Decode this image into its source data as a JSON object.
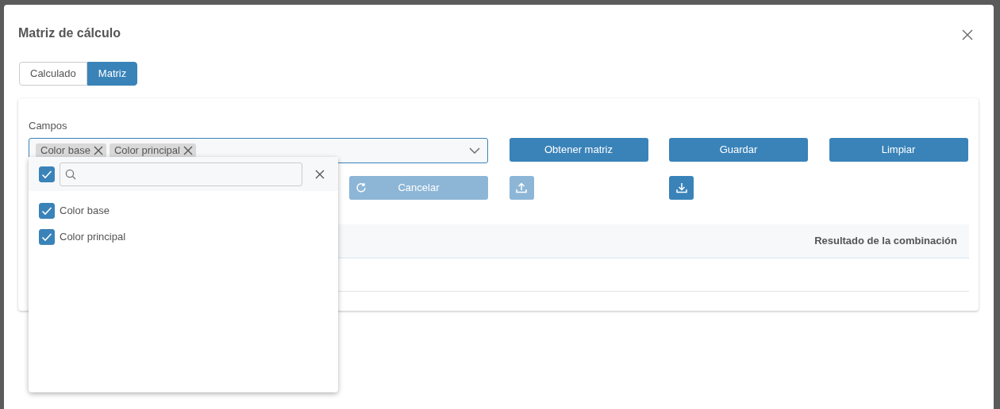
{
  "dialog": {
    "title": "Matriz de cálculo"
  },
  "tabs": [
    {
      "label": "Calculado",
      "selected": false
    },
    {
      "label": "Matriz",
      "selected": true
    }
  ],
  "fields": {
    "label": "Campos",
    "chips": [
      "Color base",
      "Color principal"
    ]
  },
  "buttons": [
    {
      "kind": "text",
      "label": "Obtener matriz",
      "disabled": false
    },
    {
      "kind": "text",
      "label": "Guardar",
      "disabled": false
    },
    {
      "kind": "text",
      "label": "Limpiar",
      "disabled": false
    }
  ],
  "secondary_buttons": [
    {
      "kind": "text",
      "label": "Cancelar",
      "disabled": true
    },
    {
      "kind": "upload",
      "disabled": true
    },
    {
      "kind": "download",
      "disabled": false
    }
  ],
  "table": {
    "columns": [
      "Resultado de la combinación"
    ]
  },
  "dropdown": {
    "select_all_checked": true,
    "options": [
      {
        "label": "Color base",
        "checked": true
      },
      {
        "label": "Color principal",
        "checked": true
      }
    ]
  }
}
